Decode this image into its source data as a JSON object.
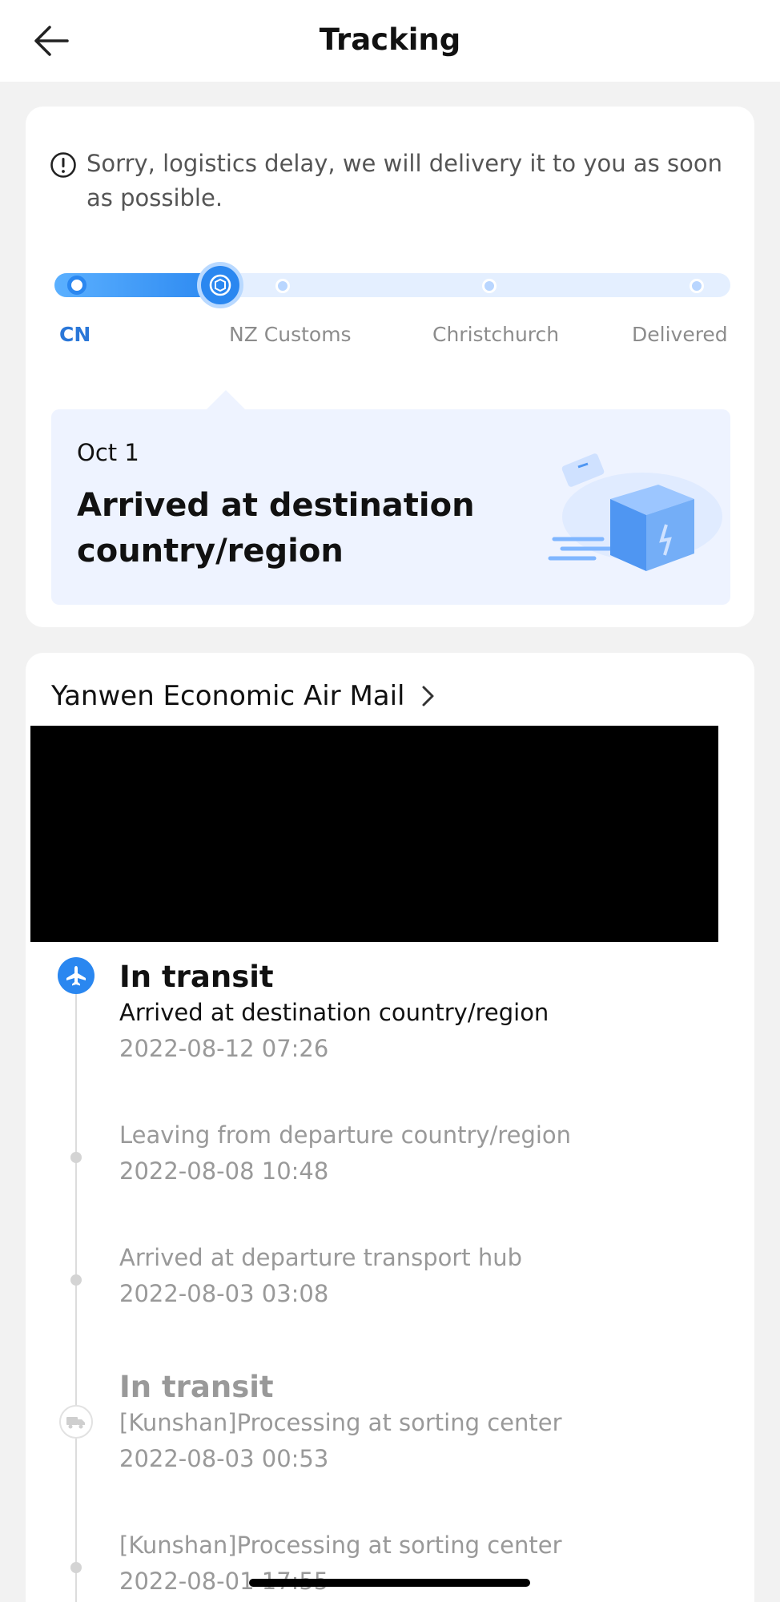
{
  "header": {
    "title": "Tracking",
    "back_icon": "arrow-left-icon"
  },
  "notice": {
    "icon": "exclamation-circle-icon",
    "text": "Sorry, logistics delay, we will delivery it to you as soon as possible."
  },
  "progress": {
    "steps": [
      {
        "label": "CN",
        "state": "done"
      },
      {
        "label": "NZ Customs",
        "state": "current"
      },
      {
        "label": "Christchurch",
        "state": "pending"
      },
      {
        "label": "Delivered",
        "state": "pending"
      }
    ],
    "current_step_index": 1,
    "accent_color": "#2a87f0"
  },
  "status_card": {
    "date": "Oct 1",
    "title": "Arrived at destination country/region",
    "illustration": "package-box-illustration"
  },
  "carrier": {
    "name": "Yanwen Economic Air Mail",
    "chevron_icon": "chevron-right-icon"
  },
  "events": [
    {
      "title": "In transit",
      "description": "Arrived at destination country/region",
      "time": "2022-08-12 07:26",
      "icon": "airplane-icon",
      "active": true
    },
    {
      "title": "",
      "description": "Leaving from departure country/region",
      "time": "2022-08-08 10:48",
      "active": false
    },
    {
      "title": "",
      "description": "Arrived at departure transport hub",
      "time": "2022-08-03 03:08",
      "active": false
    },
    {
      "title": "In transit",
      "description": "[Kunshan]Processing at sorting center",
      "time": "2022-08-03 00:53",
      "icon": "truck-icon",
      "active": false
    },
    {
      "title": "",
      "description": "[Kunshan]Processing at sorting center",
      "time": "2022-08-01 17:55",
      "active": false
    }
  ]
}
